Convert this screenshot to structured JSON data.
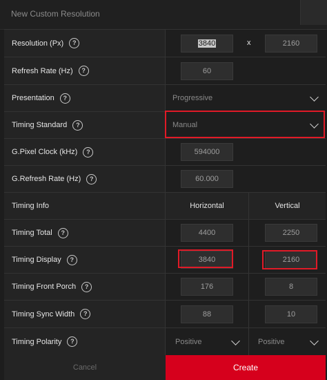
{
  "window": {
    "title": "New Custom Resolution"
  },
  "fields": {
    "resolution": {
      "label": "Resolution (Px)",
      "width": "3840",
      "sep": "x",
      "height": "2160"
    },
    "refresh_rate": {
      "label": "Refresh Rate (Hz)",
      "value": "60"
    },
    "presentation": {
      "label": "Presentation",
      "value": "Progressive"
    },
    "timing_standard": {
      "label": "Timing Standard",
      "value": "Manual"
    },
    "pixel_clock": {
      "label": "G.Pixel Clock (kHz)",
      "value": "594000"
    },
    "g_refresh_rate": {
      "label": "G.Refresh Rate (Hz)",
      "value": "60.000"
    }
  },
  "timing": {
    "info_label": "Timing Info",
    "horizontal_label": "Horizontal",
    "vertical_label": "Vertical",
    "total": {
      "label": "Timing Total",
      "h": "4400",
      "v": "2250"
    },
    "display": {
      "label": "Timing Display",
      "h": "3840",
      "v": "2160"
    },
    "front_porch": {
      "label": "Timing Front Porch",
      "h": "176",
      "v": "8"
    },
    "sync_width": {
      "label": "Timing Sync Width",
      "h": "88",
      "v": "10"
    },
    "polarity": {
      "label": "Timing Polarity",
      "h": "Positive",
      "v": "Positive"
    }
  },
  "help_glyph": "?",
  "buttons": {
    "cancel": "Cancel",
    "create": "Create"
  },
  "colors": {
    "accent": "#d6001c",
    "highlight": "#e11a27"
  }
}
